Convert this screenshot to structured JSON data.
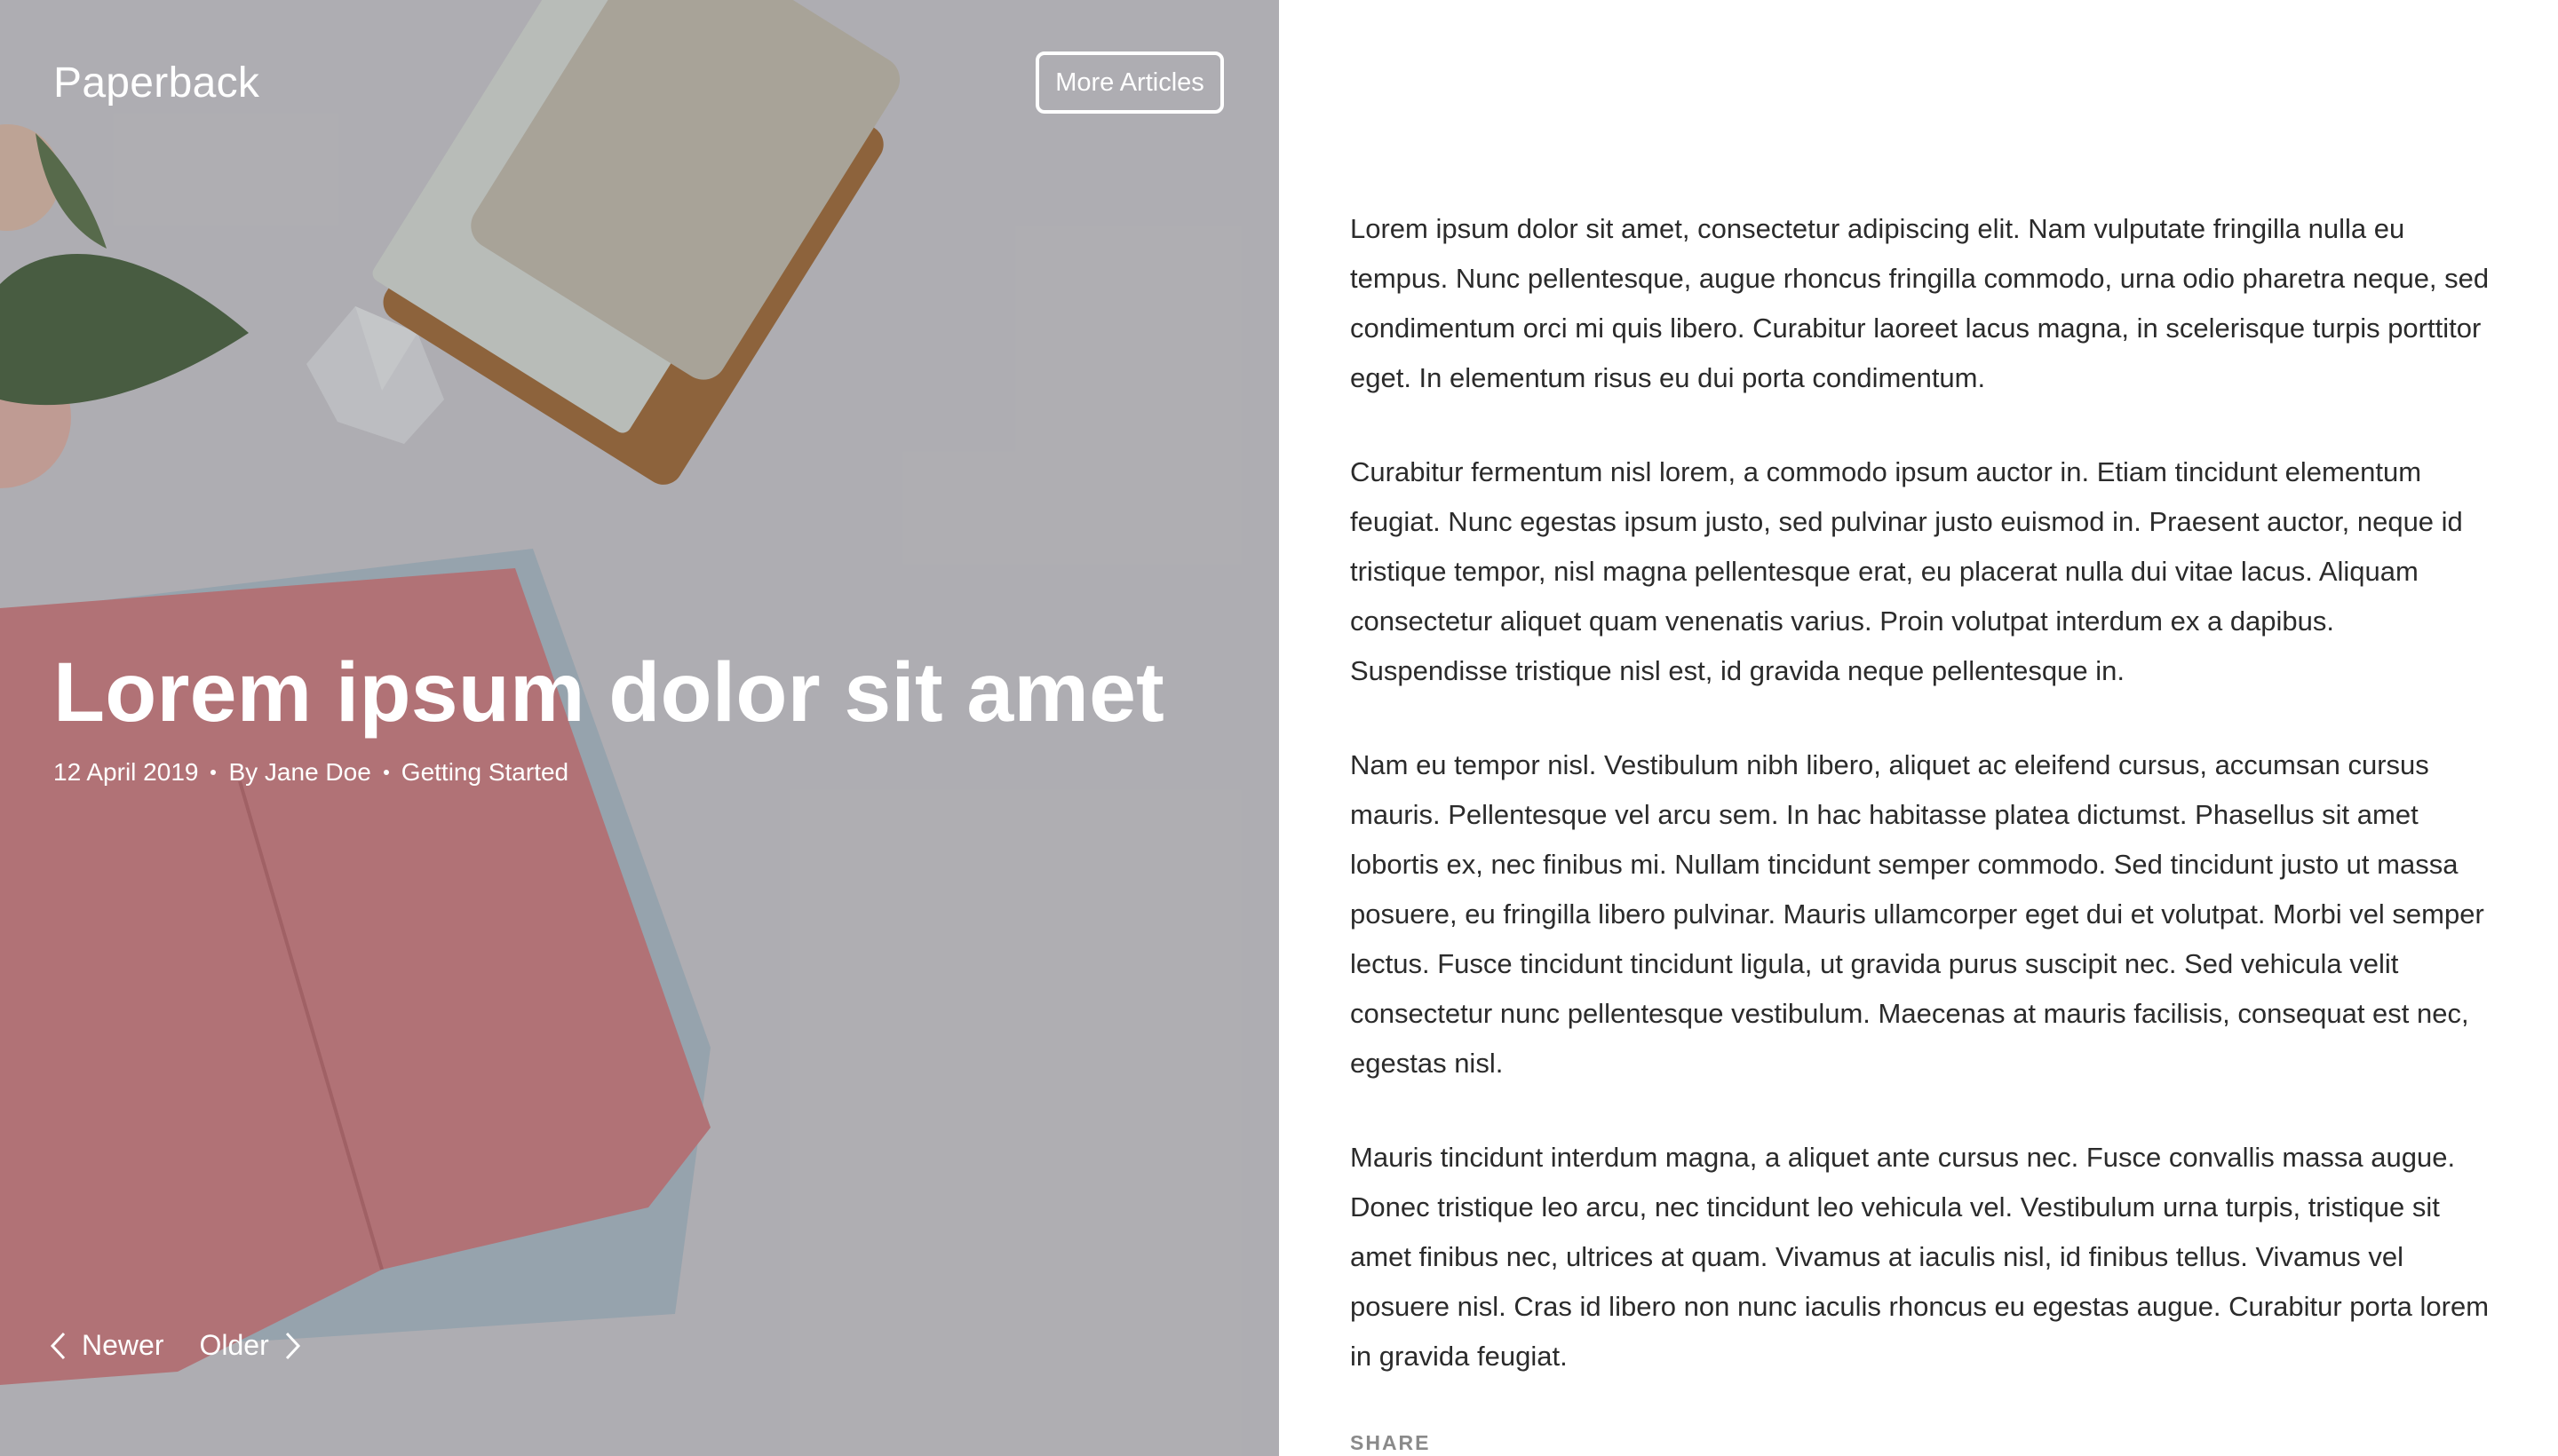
{
  "header": {
    "brand": "Paperback",
    "more_articles_label": "More Articles"
  },
  "post": {
    "title": "Lorem ipsum dolor sit amet",
    "date": "12 April 2019",
    "author": "By Jane Doe",
    "category": "Getting Started"
  },
  "pagination": {
    "newer_label": "Newer",
    "older_label": "Older"
  },
  "article": {
    "paragraphs": [
      "Lorem ipsum dolor sit amet, consectetur adipiscing elit. Nam vulputate fringilla nulla eu tempus. Nunc pellentesque, augue rhoncus fringilla commodo, urna odio pharetra neque, sed condimentum orci mi quis libero. Curabitur laoreet lacus magna, in scelerisque turpis porttitor eget. In elementum risus eu dui porta condimentum.",
      "Curabitur fermentum nisl lorem, a commodo ipsum auctor in. Etiam tincidunt elementum feugiat. Nunc egestas ipsum justo, sed pulvinar justo euismod in. Praesent auctor, neque id tristique tempor, nisl magna pellentesque erat, eu placerat nulla dui vitae lacus. Aliquam consectetur aliquet quam venenatis varius. Proin volutpat interdum ex a dapibus. Suspendisse tristique nisl est, id gravida neque pellentesque in.",
      "Nam eu tempor nisl. Vestibulum nibh libero, aliquet ac eleifend cursus, accumsan cursus mauris. Pellentesque vel arcu sem. In hac habitasse platea dictumst. Phasellus sit amet lobortis ex, nec finibus mi. Nullam tincidunt semper commodo. Sed tincidunt justo ut massa posuere, eu fringilla libero pulvinar. Mauris ullamcorper eget dui et volutpat. Morbi vel semper lectus. Fusce tincidunt tincidunt ligula, ut gravida purus suscipit nec. Sed vehicula velit consectetur nunc pellentesque vestibulum. Maecenas at mauris facilisis, consequat est nec, egestas nisl.",
      "Mauris tincidunt interdum magna, a aliquet ante cursus nec. Fusce convallis massa augue. Donec tristique leo arcu, nec tincidunt leo vehicula vel. Vestibulum urna turpis, tristique sit amet finibus nec, ultrices at quam. Vivamus at iaculis nisl, id finibus tellus. Vivamus vel posuere nisl. Cras id libero non nunc iaculis rhoncus eu egestas augue. Curabitur porta lorem in gravida feugiat."
    ],
    "share_label": "SHARE"
  },
  "icons": {
    "newer": "chevron-left-icon",
    "older": "chevron-right-icon"
  },
  "colors": {
    "hero_background": "#d4d3d6",
    "text": "#2b2b2b",
    "share": "#8a8a8a",
    "notebook_pink": "#d98a8d",
    "notebook_blue": "#b9cbd6"
  }
}
